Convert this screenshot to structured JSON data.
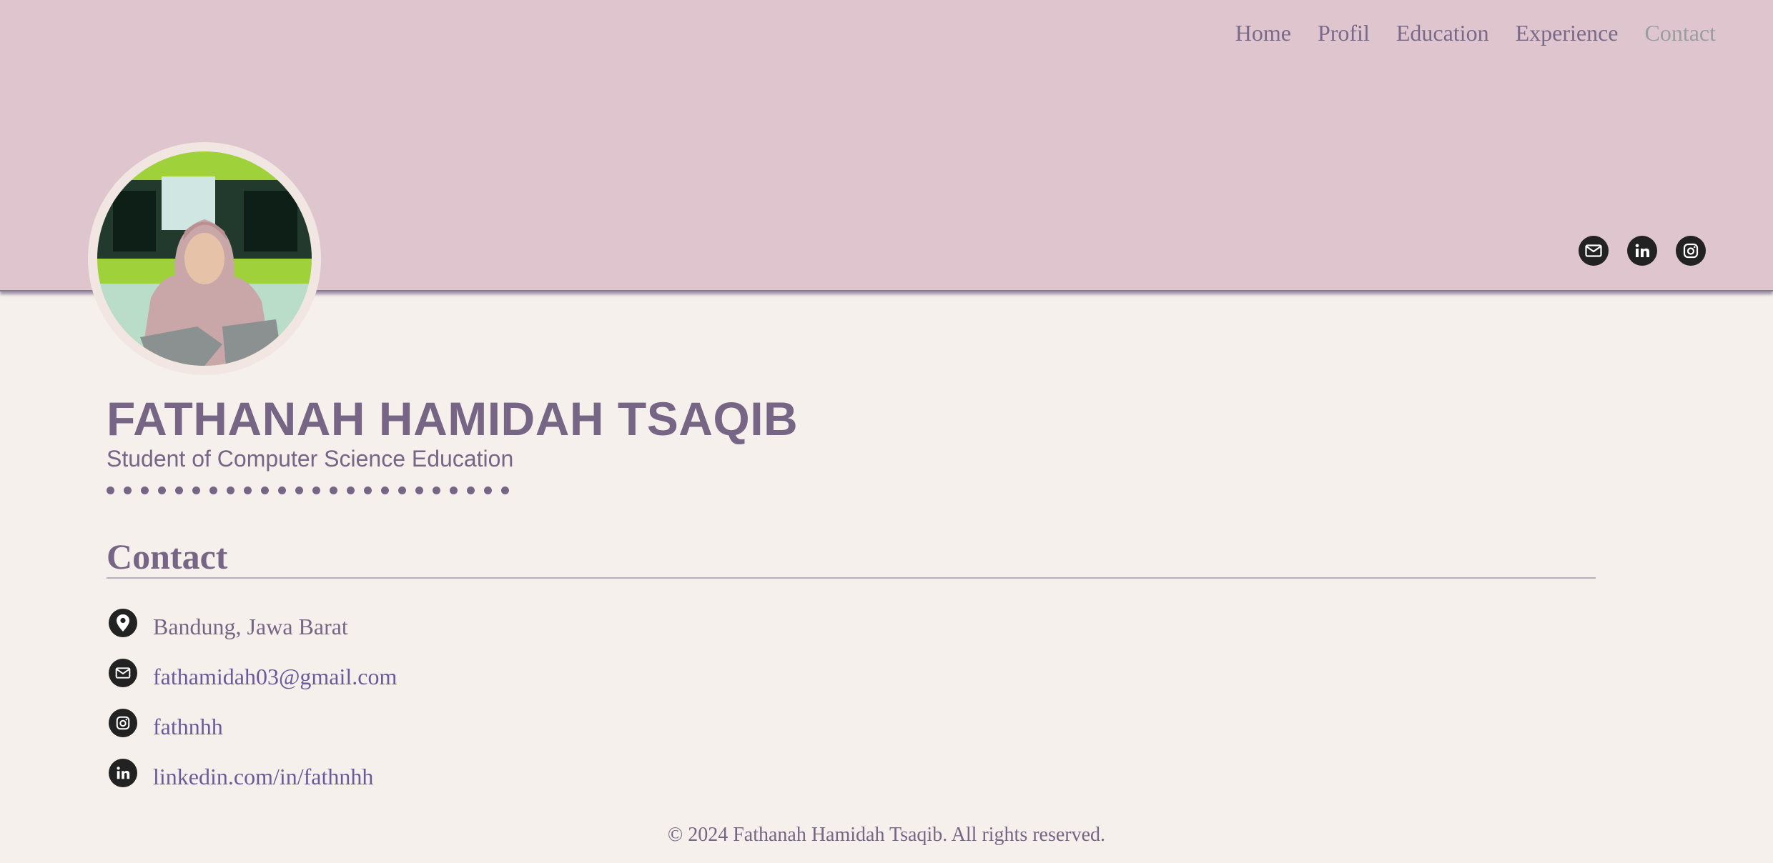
{
  "nav": {
    "items": [
      "Home",
      "Profil",
      "Education",
      "Experience",
      "Contact"
    ],
    "active": "Contact"
  },
  "social": [
    "mail-icon",
    "linkedin-icon",
    "instagram-icon"
  ],
  "profile": {
    "name": "FATHANAH HAMIDAH TSAQIB",
    "subtitle": "Student of Computer Science Education"
  },
  "contact": {
    "title": "Contact",
    "items": [
      {
        "icon": "location-pin-icon",
        "text": "Bandung, Jawa Barat"
      },
      {
        "icon": "mail-icon",
        "text": "fathamidah03@gmail.com"
      },
      {
        "icon": "instagram-icon",
        "text": "fathnhh"
      },
      {
        "icon": "linkedin-icon",
        "text": "linkedin.com/in/fathnhh"
      }
    ]
  },
  "footer": {
    "text": "© 2024 Fathanah Hamidah Tsaqib. All rights reserved."
  },
  "colors": {
    "header_bg": "#dfc6ce",
    "page_bg": "#f5f0eb",
    "accent": "#766585",
    "nav_active": "#9a9da0"
  }
}
